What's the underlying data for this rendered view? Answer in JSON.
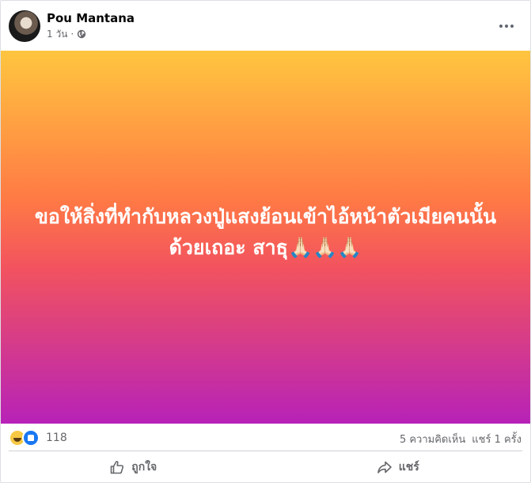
{
  "post": {
    "author": "Pou Mantana",
    "time": "1 วัน",
    "separator": "·",
    "privacy_icon": "globe-icon",
    "more_icon": "more-horizontal-icon",
    "text": "ขอให้สิ่งที่ทำกับหลวงปู่แสงย้อนเข้าไอ้หน้าตัวเมียคนนั้นด้วยเถอะ สาธุ🙏🏻🙏🏻🙏🏻",
    "background": {
      "top": "#ffc53f",
      "middle": "#ff7a45",
      "bottom": "#b722b8"
    }
  },
  "stats": {
    "reactions": [
      "haha-icon",
      "like-icon"
    ],
    "reaction_count": "118",
    "comments": "5 ความคิดเห็น",
    "shares": "แชร์ 1 ครั้ง"
  },
  "actions": {
    "like_label": "ถูกใจ",
    "share_label": "แชร์"
  }
}
